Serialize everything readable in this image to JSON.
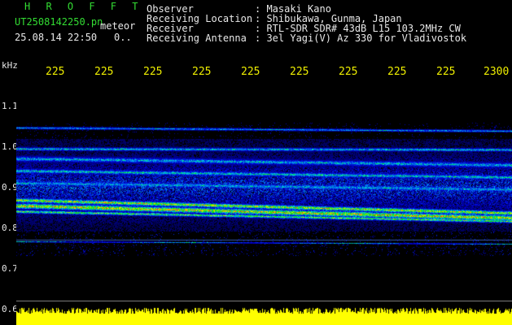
{
  "header": {
    "logo": "H R O F F T",
    "filename": "UT2508142250.pn",
    "datetime": "25.08.14 22:50",
    "suffix_meteor": "meteor",
    "suffix_zero": "0..",
    "observer_label": "Observer",
    "observer_value": ": Masaki Kano",
    "location_label": "Receiving Location",
    "location_value": ": Shibukawa, Gunma, Japan",
    "receiver_label": "Receiver",
    "receiver_value": ": RTL-SDR SDR# 43dB L15 103.2MHz CW",
    "antenna_label": "Receiving Antenna",
    "antenna_value": ": 3el Yagi(V) Az 330 for Vladivostok"
  },
  "axes": {
    "y_unit": "kHz",
    "y_ticks": [
      "1.1",
      "1.0",
      "0.9",
      "0.8",
      "0.7",
      "0.6"
    ],
    "x_ticks": [
      "225",
      "225",
      "225",
      "225",
      "225",
      "225",
      "225",
      "225",
      "225",
      "2300"
    ]
  },
  "colors": {
    "background": "#000000",
    "header_green": "#33dd33",
    "tick_yellow": "#eeee00",
    "text_white": "#e8e8e8",
    "noise_floor": "#ffff00"
  }
}
